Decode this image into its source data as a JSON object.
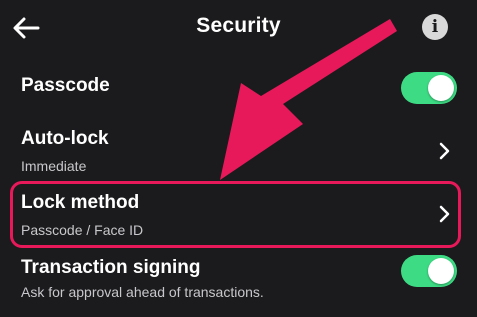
{
  "header": {
    "title": "Security",
    "back_icon": "arrow-left-icon",
    "info_icon": "info-icon",
    "info_glyph": "i"
  },
  "rows": [
    {
      "label": "Passcode",
      "control": "toggle",
      "on": true
    },
    {
      "label": "Auto-lock",
      "value": "Immediate",
      "control": "chevron"
    },
    {
      "label": "Lock method",
      "value": "Passcode / Face ID",
      "control": "chevron",
      "highlighted": true
    },
    {
      "label": "Transaction signing",
      "value": "Ask for approval ahead of transactions.",
      "control": "toggle",
      "on": true
    }
  ],
  "colors": {
    "background": "#1b1b1d",
    "toggle_on": "#3ddc84",
    "annotation": "#e8195a"
  },
  "annotation": {
    "type": "arrow",
    "target": "Lock method"
  }
}
